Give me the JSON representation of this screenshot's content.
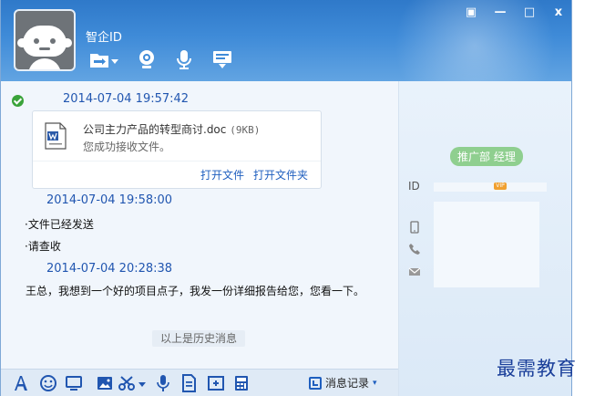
{
  "header": {
    "username": "智企ID",
    "toolbar_icons": [
      "transfer-file-icon",
      "video-icon",
      "voice-icon",
      "remote-desktop-icon"
    ],
    "window_controls": [
      "menu-icon",
      "minimize-icon",
      "maximize-icon",
      "close-icon"
    ],
    "window_control_glyphs": {
      "menu": "▣",
      "minimize": "—",
      "maximize": "□",
      "close": "x"
    }
  },
  "chat": {
    "messages": [
      {
        "time": "2014-07-04 19:57:42"
      },
      {
        "time": "2014-07-04 19:58:00",
        "lines": [
          "·文件已经发送",
          "·请查收"
        ]
      },
      {
        "time": "2014-07-04 20:28:38",
        "text": "王总，我想到一个好的项目点子，我发一份详细报告给您，您看一下。"
      }
    ],
    "file": {
      "name": "公司主力产品的转型商讨.doc",
      "size": "(9KB)",
      "status": "您成功接收文件。",
      "open_file": "打开文件",
      "open_folder": "打开文件夹"
    },
    "history_note": "以上是历史消息"
  },
  "toolbar": {
    "history_label": "消息记录",
    "history_caret": "▾",
    "icons": [
      "font-icon",
      "emoji-icon",
      "shake-icon",
      "image-icon",
      "screenshot-icon",
      "screenshot-dropdown-icon",
      "voice-message-icon",
      "doc-icon",
      "code-icon",
      "calculator-icon"
    ]
  },
  "side": {
    "role_badge": "推广部 经理",
    "id_label": "ID",
    "vip_badge": "VIP",
    "contact_icons": [
      "phone-icon",
      "telephone-icon",
      "mail-icon"
    ]
  },
  "watermark": "最需教育",
  "colors": {
    "header": "#3f8bd8",
    "accent": "#2156b0",
    "link": "#1f5fbf",
    "badge": "#8fcf8f"
  }
}
